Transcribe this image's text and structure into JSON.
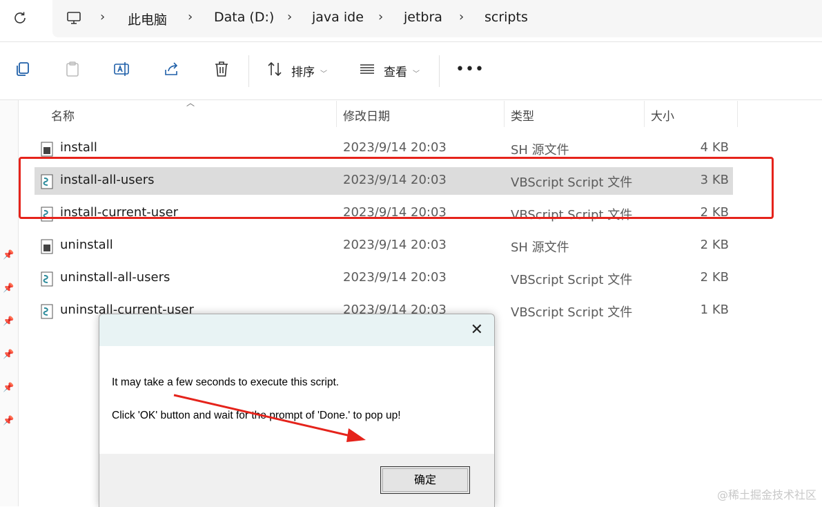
{
  "breadcrumb": {
    "items": [
      "此电脑",
      "Data (D:)",
      "java ide",
      "jetbra",
      "scripts"
    ]
  },
  "toolbar": {
    "sort_label": "排序",
    "view_label": "查看",
    "more_label": "•••"
  },
  "columns": {
    "name": "名称",
    "date": "修改日期",
    "type": "类型",
    "size": "大小"
  },
  "files": [
    {
      "name": "install",
      "date": "2023/9/14 20:03",
      "type": "SH 源文件",
      "size": "4 KB",
      "icon": "sh-file-icon"
    },
    {
      "name": "install-all-users",
      "date": "2023/9/14 20:03",
      "type": "VBScript Script 文件",
      "size": "3 KB",
      "icon": "vbs-file-icon",
      "selected": true
    },
    {
      "name": "install-current-user",
      "date": "2023/9/14 20:03",
      "type": "VBScript Script 文件",
      "size": "2 KB",
      "icon": "vbs-file-icon"
    },
    {
      "name": "uninstall",
      "date": "2023/9/14 20:03",
      "type": "SH 源文件",
      "size": "2 KB",
      "icon": "sh-file-icon"
    },
    {
      "name": "uninstall-all-users",
      "date": "2023/9/14 20:03",
      "type": "VBScript Script 文件",
      "size": "2 KB",
      "icon": "vbs-file-icon"
    },
    {
      "name": "uninstall-current-user",
      "date": "2023/9/14 20:03",
      "type": "VBScript Script 文件",
      "size": "1 KB",
      "icon": "vbs-file-icon"
    }
  ],
  "dialog": {
    "close_label": "✕",
    "message_line1": "It may take a few seconds to execute this script.",
    "message_line2": "Click 'OK' button and wait for the prompt of 'Done.' to pop up!",
    "ok_label": "确定"
  },
  "watermark": "@稀土掘金技术社区",
  "colors": {
    "highlight": "#e5231b",
    "selected_row": "#dcdcdc"
  }
}
